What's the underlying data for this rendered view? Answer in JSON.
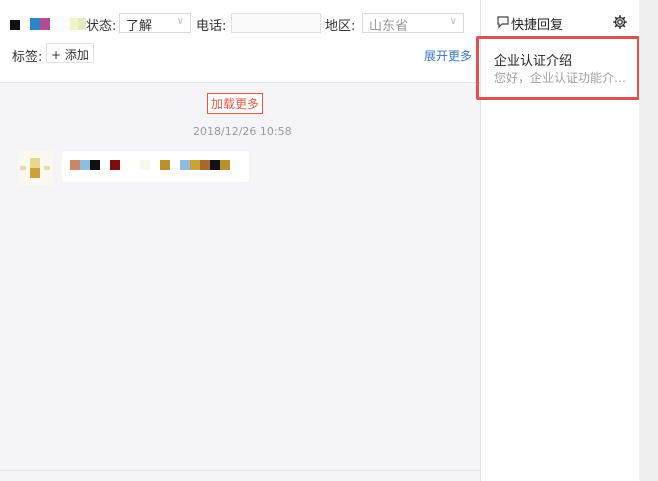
{
  "toolbar": {
    "status_label": "状态:",
    "status_value": "了解",
    "phone_label": "电话:",
    "phone_value": "",
    "region_label": "地区:",
    "region_value": "山东省",
    "tags_label": "标签:",
    "add_tag_label": "+ 添加",
    "expand_more_label": "展开更多"
  },
  "chat": {
    "load_more_label": "加载更多",
    "timestamp": "2018/12/26 10:58"
  },
  "quick_reply": {
    "title": "快捷回复",
    "items": [
      {
        "title": "企业认证介绍",
        "preview": "您好，企业认证功能介…"
      }
    ]
  },
  "colors": {
    "accent_red": "#e05050",
    "link_blue": "#3a77c0"
  }
}
